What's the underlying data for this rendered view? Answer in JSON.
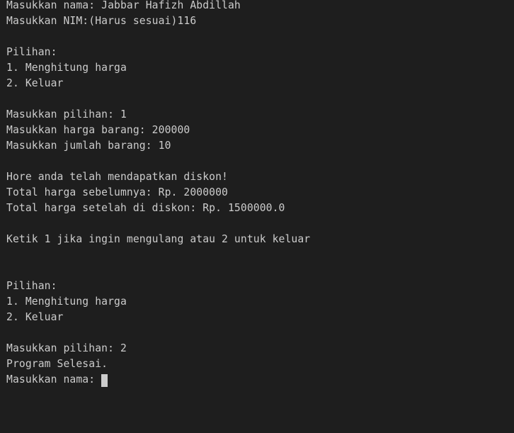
{
  "terminal": {
    "lines": [
      "Masukkan nama: Jabbar Hafizh Abdillah",
      "Masukkan NIM:(Harus sesuai)116",
      "",
      "Pilihan:",
      "1. Menghitung harga",
      "2. Keluar",
      "",
      "Masukkan pilihan: 1",
      "Masukkan harga barang: 200000",
      "Masukkan jumlah barang: 10",
      "",
      "Hore anda telah mendapatkan diskon!",
      "Total harga sebelumnya: Rp. 2000000",
      "Total harga setelah di diskon: Rp. 1500000.0",
      "",
      "Ketik 1 jika ingin mengulang atau 2 untuk keluar",
      "",
      "",
      "Pilihan:",
      "1. Menghitung harga",
      "2. Keluar",
      "",
      "Masukkan pilihan: 2",
      "Program Selesai."
    ],
    "prompt": "Masukkan nama: "
  },
  "colors": {
    "background": "#1e1e1e",
    "text": "#cccccc",
    "cursor": "#cccccc"
  }
}
